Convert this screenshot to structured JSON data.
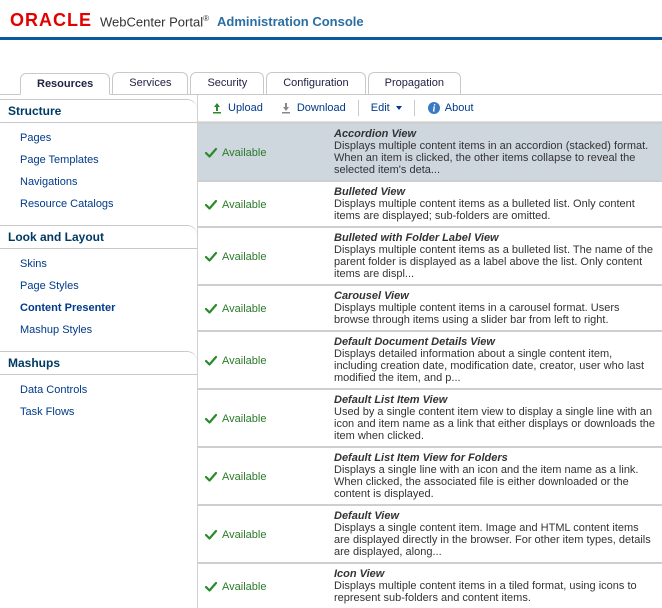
{
  "header": {
    "logo": "ORACLE",
    "product": "WebCenter Portal",
    "trademark": "®",
    "console": "Administration Console"
  },
  "tabs": [
    "Resources",
    "Services",
    "Security",
    "Configuration",
    "Propagation"
  ],
  "active_tab": 0,
  "sidebar": [
    {
      "title": "Structure",
      "items": [
        "Pages",
        "Page Templates",
        "Navigations",
        "Resource Catalogs"
      ]
    },
    {
      "title": "Look and Layout",
      "items": [
        "Skins",
        "Page Styles",
        "Content Presenter",
        "Mashup Styles"
      ]
    },
    {
      "title": "Mashups",
      "items": [
        "Data Controls",
        "Task Flows"
      ]
    }
  ],
  "active_nav": "Content Presenter",
  "toolbar": {
    "upload": "Upload",
    "download": "Download",
    "edit": "Edit",
    "about": "About"
  },
  "status_label": "Available",
  "items": [
    {
      "title": "Accordion View",
      "desc": "Displays multiple content items in an accordion (stacked) format. When an item is clicked, the other items collapse to reveal the selected item's deta..."
    },
    {
      "title": "Bulleted View",
      "desc": "Displays multiple content items as a bulleted list. Only content items are displayed; sub-folders are omitted."
    },
    {
      "title": "Bulleted with Folder Label View",
      "desc": "Displays multiple content items as a bulleted list. The name of the parent folder is displayed as a label above the list. Only content items are displ..."
    },
    {
      "title": "Carousel View",
      "desc": "Displays multiple content items in a carousel format. Users browse through items using a slider bar from left to right."
    },
    {
      "title": "Default Document Details View",
      "desc": "Displays detailed information about a single content item, including creation date, modification date, creator, user who last modified the item, and p..."
    },
    {
      "title": "Default List Item View",
      "desc": "Used by a single content item view to display a single line with an icon and item name as a link that either displays or downloads the item when clicked."
    },
    {
      "title": "Default List Item View for Folders",
      "desc": "Displays a single line with an icon and the item name as a link. When clicked, the associated file is either downloaded or the content is displayed."
    },
    {
      "title": "Default View",
      "desc": "Displays a single content item. Image and HTML content items are displayed directly in the browser. For other item types, details are displayed, along..."
    },
    {
      "title": "Icon View",
      "desc": "Displays multiple content items in a tiled format, using icons to represent sub-folders and content items."
    }
  ],
  "selected_item": 0
}
